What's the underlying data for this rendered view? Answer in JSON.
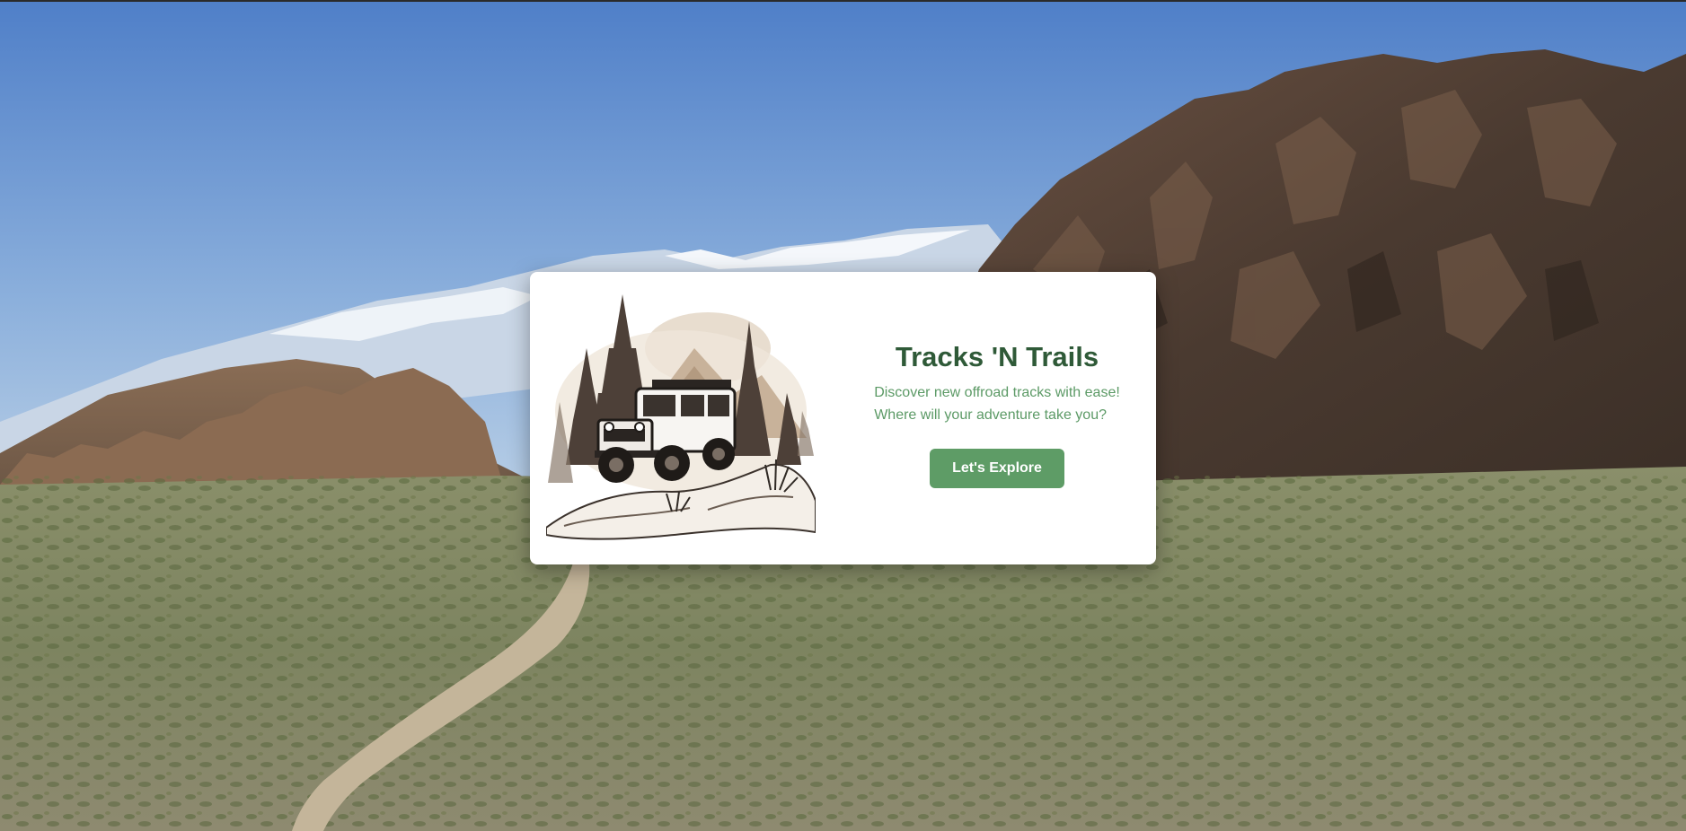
{
  "card": {
    "title": "Tracks 'N Trails",
    "tagline_line1": "Discover new offroad tracks with ease!",
    "tagline_line2": "Where will your adventure take you?",
    "button_label": "Let's Explore"
  },
  "colors": {
    "title": "#2f5a38",
    "tagline": "#5c9a66",
    "button": "#5e9c66",
    "card_bg": "#ffffff"
  },
  "background": {
    "scene": "desert valley with rock formations, snowy mountains and a dirt trail"
  }
}
